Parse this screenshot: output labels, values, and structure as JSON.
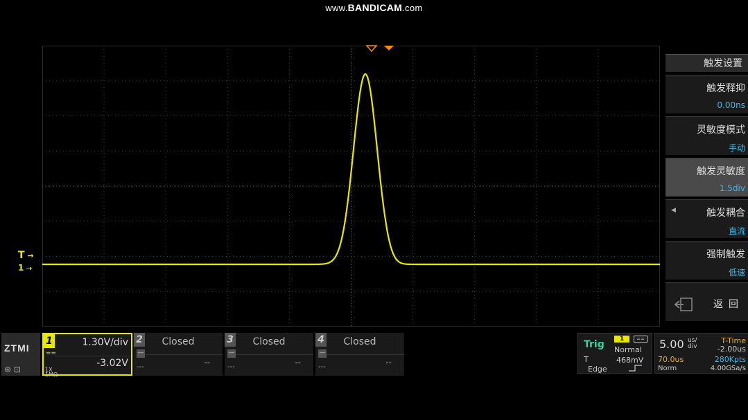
{
  "watermark": {
    "pre": "www.",
    "brand": "BANDICAM",
    "post": ".com"
  },
  "screen": {
    "trigger_marker_label": "T",
    "channel_marker_label": "1",
    "colors": {
      "trace": "#e8e800",
      "grid": "#3a3a3a",
      "trigger_pos": "#ff8a00"
    }
  },
  "menu": {
    "title": "触发设置",
    "items": [
      {
        "label": "触发释抑",
        "value": "0.00ns"
      },
      {
        "label": "灵敏度模式",
        "value": "手动"
      },
      {
        "label": "触发灵敏度",
        "value": "1.5div"
      },
      {
        "label": "触发耦合",
        "value": "直流"
      },
      {
        "label": "强制触发",
        "value": "低速"
      }
    ],
    "back_label": "返回"
  },
  "logo": "ZTMI",
  "channels": {
    "ch1": {
      "num": "1",
      "scale": "1.30V/div",
      "offset": "-3.02V",
      "coupling": "==",
      "impedance_top": "1X",
      "impedance_bottom": "1MΩ"
    },
    "ch2": {
      "num": "2",
      "state": "Closed",
      "value": "--",
      "sub": "---"
    },
    "ch3": {
      "num": "3",
      "state": "Closed",
      "value": "--",
      "sub": "---"
    },
    "ch4": {
      "num": "4",
      "state": "Closed",
      "value": "--",
      "sub": "---"
    }
  },
  "trigger": {
    "title": "Trig",
    "source": "1",
    "mode": "Normal",
    "t_symbol": "T",
    "level": "468mV",
    "type": "Edge"
  },
  "timebase": {
    "value": "5.00",
    "unit_top": "us/",
    "unit_bottom": "div",
    "ttime_label": "T-Time",
    "ttime_value": "-2.00us",
    "delay": "70.0us",
    "points": "280Kpts",
    "acq_mode": "Norm",
    "sample_rate": "4.00GSa/s"
  }
}
